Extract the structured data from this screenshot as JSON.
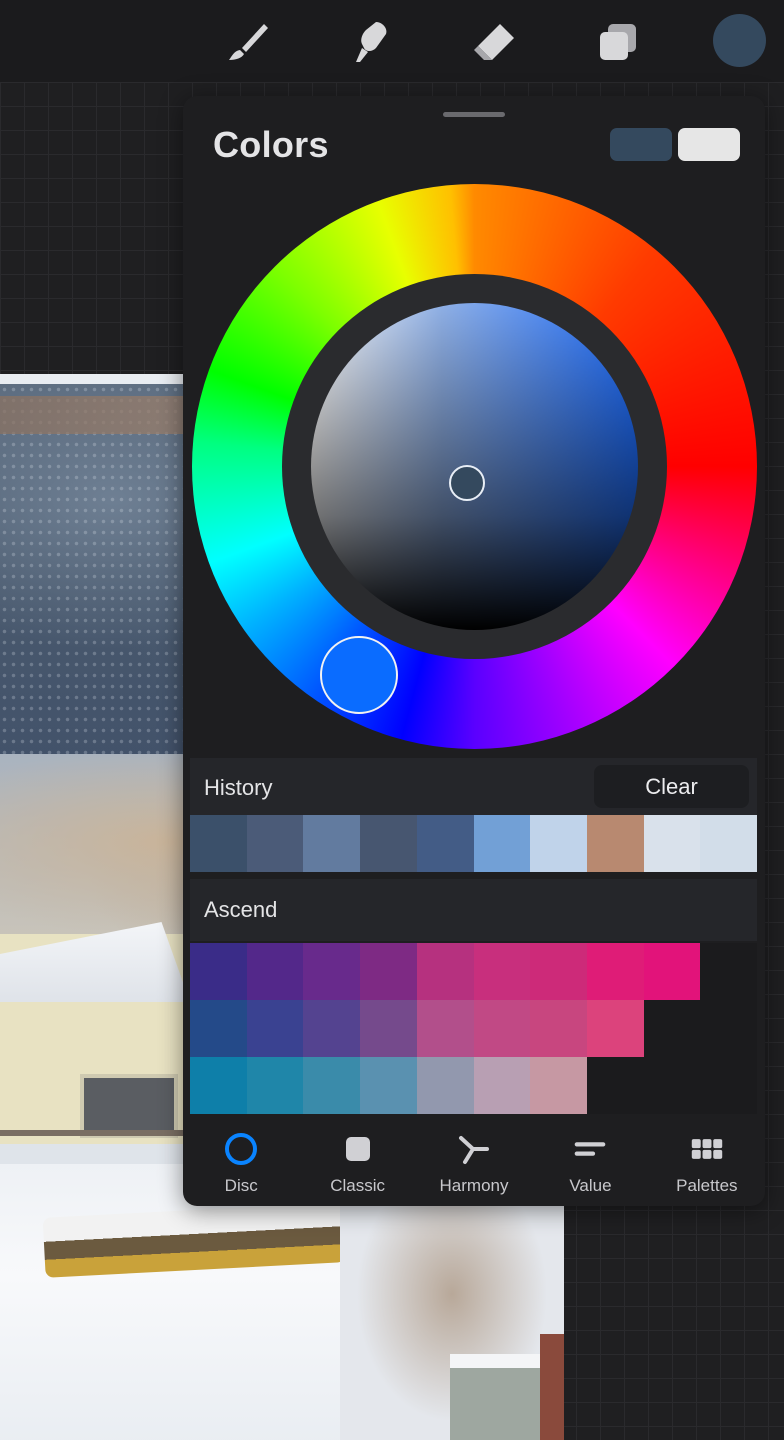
{
  "toolbar": {
    "tools": [
      {
        "name": "paintbrush-icon"
      },
      {
        "name": "smudge-icon"
      },
      {
        "name": "eraser-icon"
      },
      {
        "name": "layers-icon"
      }
    ],
    "current_color": "#34495e"
  },
  "colors_panel": {
    "title": "Colors",
    "primary_color": "#34495e",
    "secondary_color": "#e6e6e6",
    "disc": {
      "hue_handle_color": "#0a6cff",
      "saturation_handle_color": "#34495e"
    },
    "history": {
      "label": "History",
      "clear_label": "Clear",
      "swatches": [
        "#3b506a",
        "#4b5b78",
        "#627b9f",
        "#475670",
        "#435c86",
        "#72a0d6",
        "#c0d3ea",
        "#b88970",
        "#d9e1eb",
        "#d2dde9"
      ]
    },
    "palette": {
      "name": "Ascend",
      "rows": [
        [
          "#3a2c88",
          "#53288a",
          "#682a8c",
          "#7e2a84",
          "#b6317f",
          "#c82f7d",
          "#cd2a79",
          "#df1c77",
          "#e2137a",
          "#1b1b1d"
        ],
        [
          "#244a89",
          "#3a4291",
          "#544390",
          "#754a8c",
          "#b24f8b",
          "#c14985",
          "#c8467f",
          "#dc437c",
          "#1b1b1d",
          "#1b1b1d"
        ],
        [
          "#0e7fa9",
          "#1f86a9",
          "#3a8baa",
          "#5a91b0",
          "#9298ae",
          "#b89fb3",
          "#c698a3",
          "#1b1b1d",
          "#1b1b1d",
          "#1b1b1d"
        ]
      ]
    },
    "tabs": [
      {
        "label": "Disc"
      },
      {
        "label": "Classic"
      },
      {
        "label": "Harmony"
      },
      {
        "label": "Value"
      },
      {
        "label": "Palettes"
      }
    ],
    "active_tab": "Disc",
    "accent": "#0a84ff"
  }
}
